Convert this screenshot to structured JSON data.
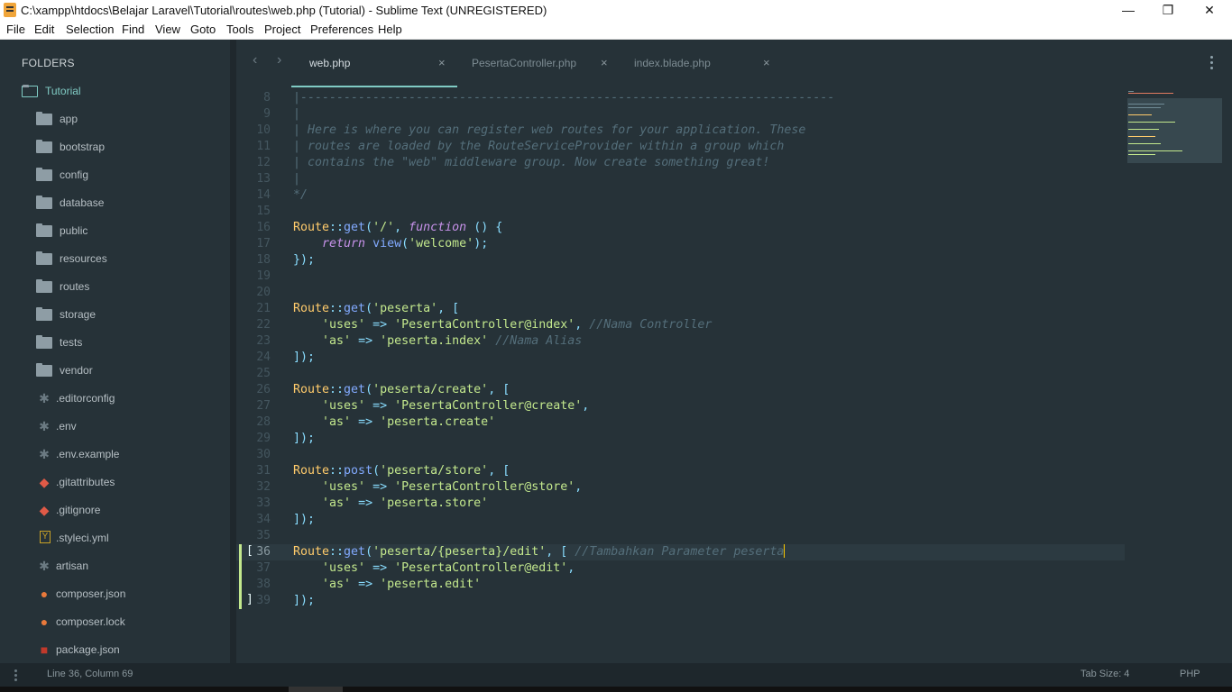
{
  "window": {
    "title": "C:\\xampp\\htdocs\\Belajar Laravel\\Tutorial\\routes\\web.php (Tutorial) - Sublime Text (UNREGISTERED)",
    "controls": {
      "minimize": "—",
      "maximize": "❐",
      "close": "✕"
    }
  },
  "menu": [
    "File",
    "Edit",
    "Selection",
    "Find",
    "View",
    "Goto",
    "Tools",
    "Project",
    "Preferences",
    "Help"
  ],
  "sidebar": {
    "header": "FOLDERS",
    "root": "Tutorial",
    "folders": [
      "app",
      "bootstrap",
      "config",
      "database",
      "public",
      "resources",
      "routes",
      "storage",
      "tests",
      "vendor"
    ],
    "files": [
      {
        "name": ".editorconfig",
        "icon": "asterisk-icon",
        "glyph": "✱",
        "color": "#6b7a82"
      },
      {
        "name": ".env",
        "icon": "asterisk-icon",
        "glyph": "✱",
        "color": "#6b7a82"
      },
      {
        "name": ".env.example",
        "icon": "asterisk-icon",
        "glyph": "✱",
        "color": "#6b7a82"
      },
      {
        "name": ".gitattributes",
        "icon": "git-icon",
        "glyph": "◆",
        "color": "#e05a47"
      },
      {
        "name": ".gitignore",
        "icon": "git-icon",
        "glyph": "◆",
        "color": "#e05a47"
      },
      {
        "name": ".styleci.yml",
        "icon": "yaml-icon",
        "glyph": "Y",
        "color": "#c9a227"
      },
      {
        "name": "artisan",
        "icon": "asterisk-icon",
        "glyph": "✱",
        "color": "#6b7a82"
      },
      {
        "name": "composer.json",
        "icon": "composer-icon",
        "glyph": "●",
        "color": "#e8793b"
      },
      {
        "name": "composer.lock",
        "icon": "composer-icon",
        "glyph": "●",
        "color": "#e8793b"
      },
      {
        "name": "package.json",
        "icon": "npm-icon",
        "glyph": "■",
        "color": "#c0392b"
      }
    ]
  },
  "tabs": [
    {
      "label": "web.php",
      "active": true
    },
    {
      "label": "PesertaController.php",
      "active": false
    },
    {
      "label": "index.blade.php",
      "active": false
    }
  ],
  "tab_close": "×",
  "editor": {
    "first_line": 8,
    "current_line": 36,
    "lines": [
      [
        [
          "c-com",
          "|--------------------------------------------------------------------------"
        ]
      ],
      [
        [
          "c-com",
          "|"
        ]
      ],
      [
        [
          "c-com",
          "| Here is where you can register web routes for your application. These"
        ]
      ],
      [
        [
          "c-com",
          "| routes are loaded by the RouteServiceProvider within a group which"
        ]
      ],
      [
        [
          "c-com",
          "| contains the \"web\" middleware group. Now create something great!"
        ]
      ],
      [
        [
          "c-com",
          "|"
        ]
      ],
      [
        [
          "c-com",
          "*/"
        ]
      ],
      [],
      [
        [
          "c-fn",
          "Route"
        ],
        [
          "c-op",
          "::"
        ],
        [
          "c-meth",
          "get"
        ],
        [
          "c-pun",
          "("
        ],
        [
          "c-str",
          "'/'"
        ],
        [
          "c-pun",
          ", "
        ],
        [
          "c-kw",
          "function"
        ],
        [
          "c-pun",
          " () {"
        ]
      ],
      [
        [
          "c-plain",
          "    "
        ],
        [
          "c-kw",
          "return"
        ],
        [
          "c-plain",
          " "
        ],
        [
          "c-meth",
          "view"
        ],
        [
          "c-pun",
          "("
        ],
        [
          "c-str",
          "'welcome'"
        ],
        [
          "c-pun",
          ");"
        ]
      ],
      [
        [
          "c-pun",
          "});"
        ]
      ],
      [],
      [],
      [
        [
          "c-fn",
          "Route"
        ],
        [
          "c-op",
          "::"
        ],
        [
          "c-meth",
          "get"
        ],
        [
          "c-pun",
          "("
        ],
        [
          "c-str",
          "'peserta'"
        ],
        [
          "c-pun",
          ", ["
        ]
      ],
      [
        [
          "c-plain",
          "    "
        ],
        [
          "c-str",
          "'uses'"
        ],
        [
          "c-op",
          " => "
        ],
        [
          "c-str",
          "'PesertaController@index'"
        ],
        [
          "c-pun",
          ", "
        ],
        [
          "c-com",
          "//Nama Controller"
        ]
      ],
      [
        [
          "c-plain",
          "    "
        ],
        [
          "c-str",
          "'as'"
        ],
        [
          "c-op",
          " => "
        ],
        [
          "c-str",
          "'peserta.index'"
        ],
        [
          "c-plain",
          " "
        ],
        [
          "c-com",
          "//Nama Alias"
        ]
      ],
      [
        [
          "c-pun",
          "]);"
        ]
      ],
      [],
      [
        [
          "c-fn",
          "Route"
        ],
        [
          "c-op",
          "::"
        ],
        [
          "c-meth",
          "get"
        ],
        [
          "c-pun",
          "("
        ],
        [
          "c-str",
          "'peserta/create'"
        ],
        [
          "c-pun",
          ", ["
        ]
      ],
      [
        [
          "c-plain",
          "    "
        ],
        [
          "c-str",
          "'uses'"
        ],
        [
          "c-op",
          " => "
        ],
        [
          "c-str",
          "'PesertaController@create'"
        ],
        [
          "c-pun",
          ","
        ]
      ],
      [
        [
          "c-plain",
          "    "
        ],
        [
          "c-str",
          "'as'"
        ],
        [
          "c-op",
          " => "
        ],
        [
          "c-str",
          "'peserta.create'"
        ]
      ],
      [
        [
          "c-pun",
          "]);"
        ]
      ],
      [],
      [
        [
          "c-fn",
          "Route"
        ],
        [
          "c-op",
          "::"
        ],
        [
          "c-meth",
          "post"
        ],
        [
          "c-pun",
          "("
        ],
        [
          "c-str",
          "'peserta/store'"
        ],
        [
          "c-pun",
          ", ["
        ]
      ],
      [
        [
          "c-plain",
          "    "
        ],
        [
          "c-str",
          "'uses'"
        ],
        [
          "c-op",
          " => "
        ],
        [
          "c-str",
          "'PesertaController@store'"
        ],
        [
          "c-pun",
          ","
        ]
      ],
      [
        [
          "c-plain",
          "    "
        ],
        [
          "c-str",
          "'as'"
        ],
        [
          "c-op",
          " => "
        ],
        [
          "c-str",
          "'peserta.store'"
        ]
      ],
      [
        [
          "c-pun",
          "]);"
        ]
      ],
      [],
      [
        [
          "c-fn",
          "Route"
        ],
        [
          "c-op",
          "::"
        ],
        [
          "c-meth",
          "get"
        ],
        [
          "c-pun",
          "("
        ],
        [
          "c-str",
          "'peserta/{peserta}/edit'"
        ],
        [
          "c-pun",
          ", [ "
        ],
        [
          "c-com",
          "//Tambahkan Parameter peserta"
        ],
        [
          "cursor",
          ""
        ]
      ],
      [
        [
          "c-plain",
          "    "
        ],
        [
          "c-str",
          "'uses'"
        ],
        [
          "c-op",
          " => "
        ],
        [
          "c-str",
          "'PesertaController@edit'"
        ],
        [
          "c-pun",
          ","
        ]
      ],
      [
        [
          "c-plain",
          "    "
        ],
        [
          "c-str",
          "'as'"
        ],
        [
          "c-op",
          " => "
        ],
        [
          "c-str",
          "'peserta.edit'"
        ]
      ],
      [
        [
          "c-pun",
          "]);"
        ]
      ]
    ],
    "bracket_open": "[",
    "bracket_close": "]"
  },
  "status": {
    "position": "Line 36, Column 69",
    "tab_size": "Tab Size: 4",
    "syntax": "PHP"
  },
  "colors": {
    "background": "#263238",
    "accent": "#80cbc4",
    "string": "#c3e88d",
    "function": "#ffcb6b",
    "keyword": "#c792ea",
    "comment": "#546e7a"
  }
}
